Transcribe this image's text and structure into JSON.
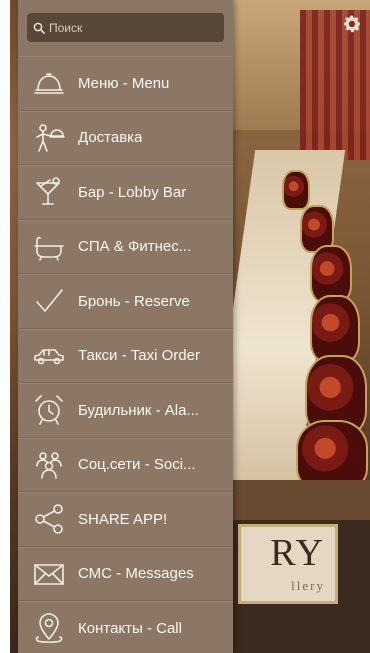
{
  "search": {
    "placeholder": "Поиск",
    "value": ""
  },
  "menu": {
    "items": [
      {
        "label": "Меню - Menu",
        "icon": "cloche-icon"
      },
      {
        "label": "Доставка",
        "icon": "delivery-waiter-icon"
      },
      {
        "label": "Бар - Lobby Bar",
        "icon": "cocktail-icon"
      },
      {
        "label": "СПА & Фитнес...",
        "icon": "bathtub-icon"
      },
      {
        "label": "Бронь - Reserve",
        "icon": "checkmark-icon"
      },
      {
        "label": "Такси - Taxi Order",
        "icon": "car-icon"
      },
      {
        "label": "Будильник - Ala...",
        "icon": "alarm-clock-icon"
      },
      {
        "label": "Соц.сети - Soci...",
        "icon": "people-icon"
      },
      {
        "label": "SHARE APP!",
        "icon": "share-icon"
      },
      {
        "label": "СМС - Messages",
        "icon": "envelope-icon"
      },
      {
        "label": "Контакты - Call",
        "icon": "location-pin-icon"
      }
    ]
  },
  "background": {
    "logo_text": "RY",
    "logo_subtext": "llery"
  },
  "colors": {
    "drawer": "#8c7766",
    "search_field": "#574739",
    "text": "#fbf7f1"
  }
}
